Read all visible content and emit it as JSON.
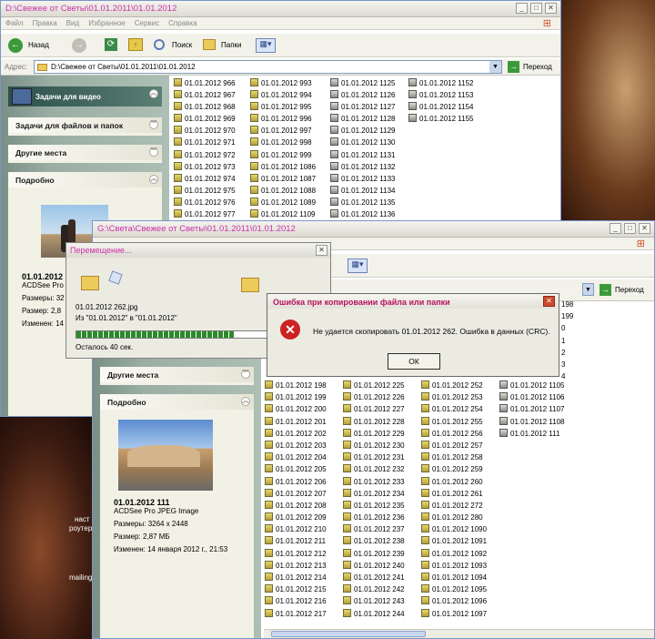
{
  "window1": {
    "title": "D:\\Свежее от Светы\\01.01.2011\\01.01.2012",
    "menu": [
      "Файл",
      "Правка",
      "Вид",
      "Избранное",
      "Сервис",
      "Справка"
    ],
    "toolbar": {
      "back": "Назад",
      "search": "Поиск",
      "folders": "Папки"
    },
    "address": {
      "label": "Адрес:",
      "value": "D:\\Свежее от Светы\\01.01.2011\\01.01.2012",
      "go": "Переход"
    },
    "taskpane": {
      "video_tasks": "Задачи для видео",
      "file_tasks": "Задачи для файлов и папок",
      "other_places": "Другие места",
      "details": "Подробно"
    },
    "details": {
      "name": "01.01.2012",
      "type": "ACDSee Pro",
      "dims": "Размеры: 32",
      "size": "Размер: 2,8",
      "modified": "Изменен: 14"
    },
    "files": [
      [
        "01.01.2012 966",
        "01.01.2012 967",
        "01.01.2012 968",
        "01.01.2012 969",
        "01.01.2012 970",
        "01.01.2012 971",
        "01.01.2012 972",
        "01.01.2012 973",
        "01.01.2012 974",
        "01.01.2012 975",
        "01.01.2012 976",
        "01.01.2012 977"
      ],
      [
        "01.01.2012 993",
        "01.01.2012 994",
        "01.01.2012 995",
        "01.01.2012 996",
        "01.01.2012 997",
        "01.01.2012 998",
        "01.01.2012 999",
        "01.01.2012 1086",
        "01.01.2012 1087",
        "01.01.2012 1088",
        "01.01.2012 1089",
        "01.01.2012 1109"
      ],
      [
        "01.01.2012 1125",
        "01.01.2012 1126",
        "01.01.2012 1127",
        "01.01.2012 1128",
        "01.01.2012 1129",
        "01.01.2012 1130",
        "01.01.2012 1131",
        "01.01.2012 1132",
        "01.01.2012 1133",
        "01.01.2012 1134",
        "01.01.2012 1135",
        "01.01.2012 1136"
      ],
      [
        "01.01.2012 1152",
        "01.01.2012 1153",
        "01.01.2012 1154",
        "01.01.2012 1155"
      ]
    ]
  },
  "window2": {
    "title": "G:\\Света\\Свежее от Светы\\01.01.2011\\01.01.2012",
    "address": {
      "go": "Переход"
    },
    "taskpane": {
      "other_places": "Другие места",
      "details": "Подробно"
    },
    "details": {
      "name": "01.01.2012 111",
      "type": "ACDSee Pro JPEG Image",
      "dims": "Размеры: 3264 x 2448",
      "size": "Размер: 2,87 МБ",
      "modified": "Изменен: 14 января 2012 г., 21:53"
    },
    "top_right_files": [
      "198",
      "199",
      "0",
      "1",
      "2",
      "3",
      "4"
    ],
    "files": [
      [
        "01.01.2012 198",
        "01.01.2012 199",
        "01.01.2012 200",
        "01.01.2012 201",
        "01.01.2012 202",
        "01.01.2012 203",
        "01.01.2012 204",
        "01.01.2012 205",
        "01.01.2012 206",
        "01.01.2012 207",
        "01.01.2012 208",
        "01.01.2012 209",
        "01.01.2012 210",
        "01.01.2012 211",
        "01.01.2012 212",
        "01.01.2012 213",
        "01.01.2012 214",
        "01.01.2012 215",
        "01.01.2012 216",
        "01.01.2012 217"
      ],
      [
        "01.01.2012 225",
        "01.01.2012 226",
        "01.01.2012 227",
        "01.01.2012 228",
        "01.01.2012 229",
        "01.01.2012 230",
        "01.01.2012 231",
        "01.01.2012 232",
        "01.01.2012 233",
        "01.01.2012 234",
        "01.01.2012 235",
        "01.01.2012 236",
        "01.01.2012 237",
        "01.01.2012 238",
        "01.01.2012 239",
        "01.01.2012 240",
        "01.01.2012 241",
        "01.01.2012 242",
        "01.01.2012 243",
        "01.01.2012 244"
      ],
      [
        "01.01.2012 252",
        "01.01.2012 253",
        "01.01.2012 254",
        "01.01.2012 255",
        "01.01.2012 256",
        "01.01.2012 257",
        "01.01.2012 258",
        "01.01.2012 259",
        "01.01.2012 260",
        "01.01.2012 261",
        "01.01.2012 272",
        "01.01.2012 280",
        "01.01.2012 1090",
        "01.01.2012 1091",
        "01.01.2012 1092",
        "01.01.2012 1093",
        "01.01.2012 1094",
        "01.01.2012 1095",
        "01.01.2012 1096",
        "01.01.2012 1097"
      ],
      [
        "01.01.2012 1105",
        "01.01.2012 1106",
        "01.01.2012 1107",
        "01.01.2012 1108",
        "01.01.2012 111"
      ]
    ]
  },
  "move_dialog": {
    "title": "Перемещение...",
    "filename": "01.01.2012 262.jpg",
    "from_to": "Из \"01.01.2012\" в \"01.01.2012\"",
    "remaining": "Осталось 40 сек.",
    "progress": 0.65
  },
  "error_dialog": {
    "title": "Ошибка при копировании файла или папки",
    "message": "Не удается скопировать 01.01.2012 262. Ошибка в данных (CRC).",
    "ok": "ОК"
  },
  "desktop": {
    "text1": "наст",
    "text2": "роутер",
    "text3": "mailing"
  }
}
